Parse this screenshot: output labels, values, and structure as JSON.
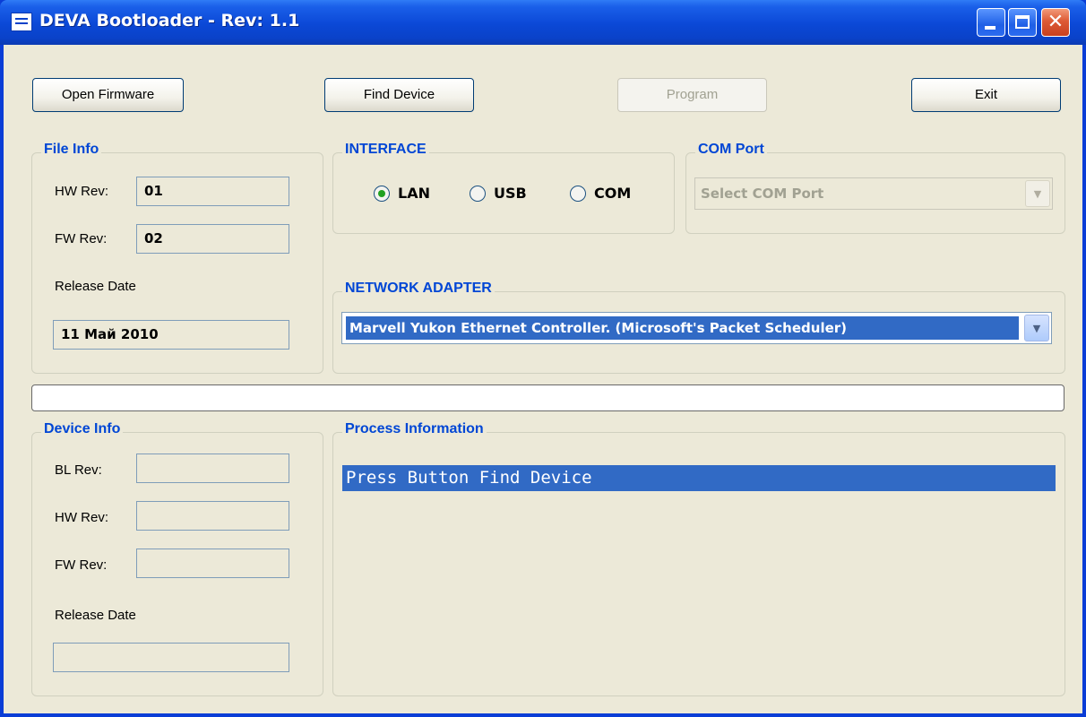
{
  "window": {
    "title": "DEVA Bootloader - Rev: 1.1",
    "icons": {
      "app": "app-window-icon",
      "minimize": "minimize-icon",
      "maximize": "maximize-icon",
      "close": "close-icon"
    }
  },
  "toolbar": {
    "open_firmware": "Open Firmware",
    "find_device": "Find Device",
    "program": "Program",
    "exit": "Exit"
  },
  "file_info": {
    "title": "File Info",
    "hw_rev_label": "HW Rev:",
    "hw_rev_value": "01",
    "fw_rev_label": "FW Rev:",
    "fw_rev_value": "02",
    "release_date_label": "Release Date",
    "release_date_value": "11 Май 2010"
  },
  "interface": {
    "title": "INTERFACE",
    "options": [
      {
        "label": "LAN",
        "checked": true
      },
      {
        "label": "USB",
        "checked": false
      },
      {
        "label": "COM",
        "checked": false
      }
    ]
  },
  "com_port": {
    "title": "COM Port",
    "selected": "Select COM Port",
    "enabled": false
  },
  "network_adapter": {
    "title": "NETWORK ADAPTER",
    "selected": "Marvell Yukon Ethernet Controller. (Microsoft's Packet Scheduler)"
  },
  "progress": {
    "value": 0
  },
  "device_info": {
    "title": "Device Info",
    "bl_rev_label": "BL Rev:",
    "bl_rev_value": "",
    "hw_rev_label": "HW Rev:",
    "hw_rev_value": "",
    "fw_rev_label": "FW Rev:",
    "fw_rev_value": "",
    "release_date_label": "Release Date",
    "release_date_value": ""
  },
  "process_info": {
    "title": "Process Information",
    "lines": [
      "Press Button Find Device"
    ]
  },
  "colors": {
    "accent": "#0046d5",
    "selection": "#316ac5",
    "face": "#ece9d8",
    "titlebar": "#0a42c9"
  }
}
